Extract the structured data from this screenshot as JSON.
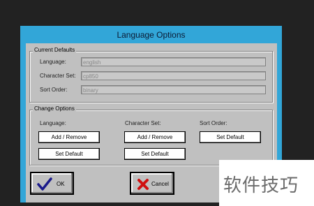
{
  "dialog": {
    "title": "Language Options",
    "current_defaults": {
      "group_label": "Current Defaults",
      "language_label": "Language:",
      "language_value": "english",
      "charset_label": "Character Set:",
      "charset_value": "cp850",
      "sort_label": "Sort Order:",
      "sort_value": "binary"
    },
    "change_options": {
      "group_label": "Change Options",
      "language_label": "Language:",
      "charset_label": "Character Set:",
      "sort_label": "Sort Order:",
      "add_remove": "Add / Remove",
      "set_default": "Set Default"
    },
    "ok_label": "OK",
    "cancel_label": "Cancel"
  },
  "watermark": {
    "text": "软件技巧"
  },
  "colors": {
    "title_bar": "#32a6d8",
    "client": "#c0c0c0"
  },
  "icons": {
    "ok": "checkmark-icon",
    "cancel": "red-x-icon"
  }
}
